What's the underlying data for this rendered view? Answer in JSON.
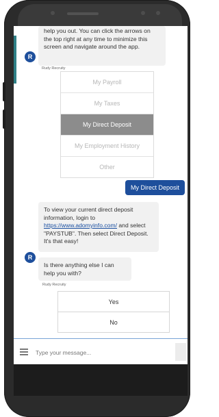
{
  "chat": {
    "intro_message": "help you out.  You can click the arrows on the top right at any time to minimize this screen and navigate around the app.",
    "sender_name": "Rudy Recruity",
    "avatar_letter": "R",
    "options": [
      {
        "label": "My Payroll",
        "selected": false
      },
      {
        "label": "My Taxes",
        "selected": false
      },
      {
        "label": "My Direct Deposit",
        "selected": true
      },
      {
        "label": "My Employment History",
        "selected": false
      },
      {
        "label": "Other",
        "selected": false
      }
    ],
    "user_reply": "My Direct Deposit",
    "deposit_message_pre": "To view your current direct deposit information, login to ",
    "deposit_link": "https://www.adomyinfo.com/",
    "deposit_message_post": " and select \"PAYSTUB\".  Then select Direct Deposit.  It's that easy!",
    "followup_message": "Is there anything else I can help you with?",
    "followup_sender": "Rudy Recruity",
    "yes_label": "Yes",
    "no_label": "No"
  },
  "input": {
    "placeholder": "Type your message..."
  },
  "colors": {
    "accent": "#1e4f9c",
    "selected_option": "#8c8c8c",
    "bubble": "#f1f1f1"
  }
}
